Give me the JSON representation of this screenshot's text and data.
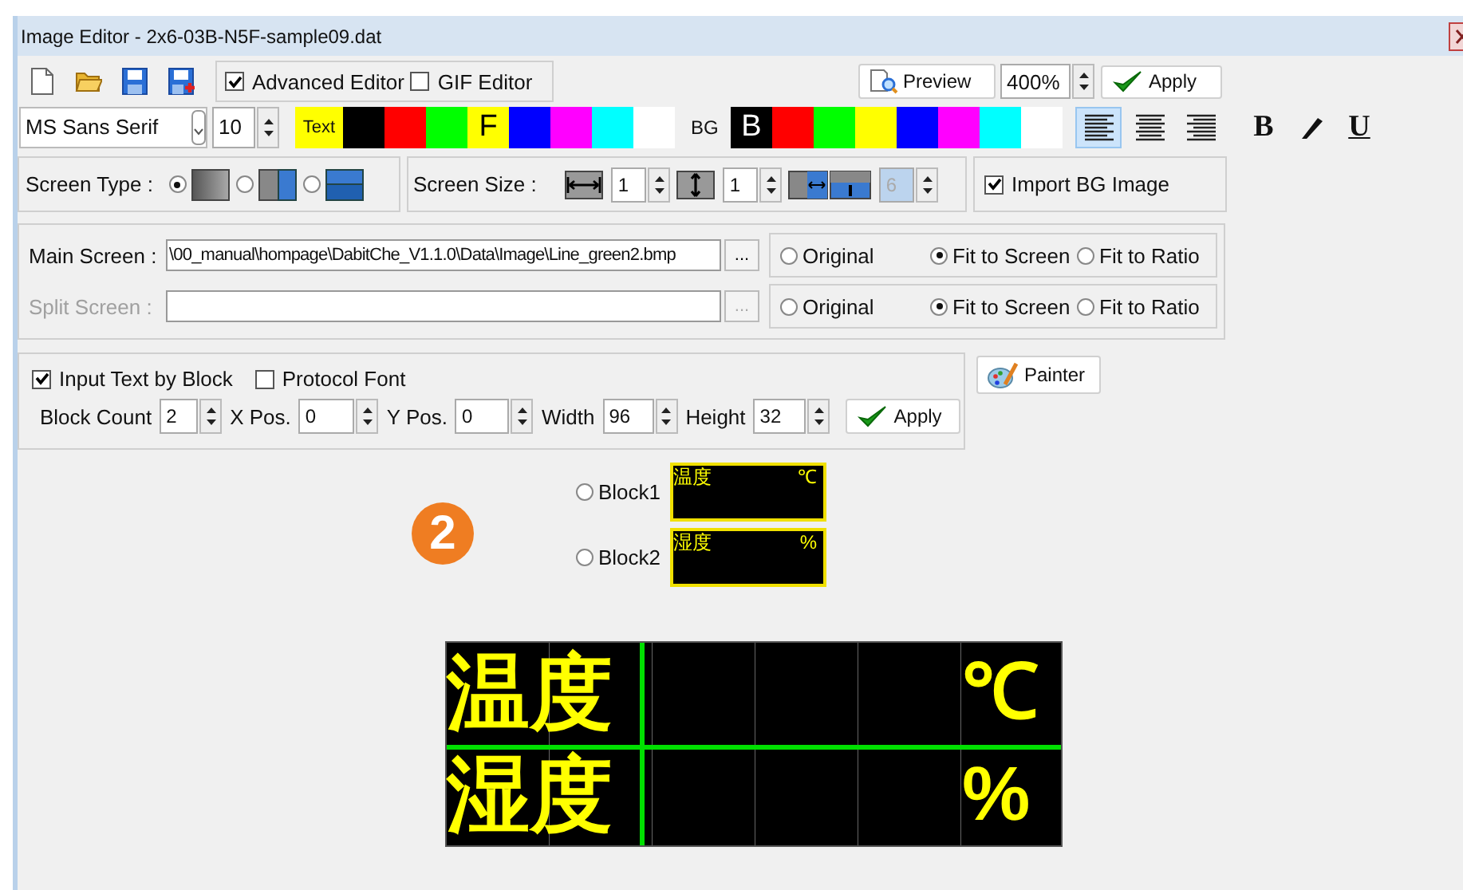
{
  "window": {
    "title": "Image Editor - 2x6-03B-N5F-sample09.dat"
  },
  "toolbar": {
    "editors": [
      {
        "label": "Advanced Editor",
        "checked": true
      },
      {
        "label": "GIF Editor",
        "checked": false
      }
    ],
    "preview_button": "Preview",
    "zoom": "400%",
    "apply_button": "Apply"
  },
  "format_bar": {
    "font": "MS Sans Serif",
    "size": "10",
    "text_label": "Text",
    "text_marker": "F",
    "text_colors": [
      {
        "color": "#000000",
        "selected": false
      },
      {
        "color": "#ff0000",
        "selected": false
      },
      {
        "color": "#00ff00",
        "selected": false
      },
      {
        "color": "#ffff00",
        "selected": true
      },
      {
        "color": "#0000ff",
        "selected": false
      },
      {
        "color": "#ff00ff",
        "selected": false
      },
      {
        "color": "#00ffff",
        "selected": false
      },
      {
        "color": "#ffffff",
        "selected": false
      }
    ],
    "bg_label": "BG",
    "bg_marker": "B",
    "bg_colors": [
      {
        "color": "#000000",
        "selected": true
      },
      {
        "color": "#ff0000",
        "selected": false
      },
      {
        "color": "#00ff00",
        "selected": false
      },
      {
        "color": "#ffff00",
        "selected": false
      },
      {
        "color": "#0000ff",
        "selected": false
      },
      {
        "color": "#ff00ff",
        "selected": false
      },
      {
        "color": "#00ffff",
        "selected": false
      },
      {
        "color": "#ffffff",
        "selected": false
      }
    ],
    "alignments": [
      {
        "kind": "left",
        "selected": true
      },
      {
        "kind": "center",
        "selected": false
      },
      {
        "kind": "right",
        "selected": false
      }
    ],
    "styles": [
      {
        "kind": "bold",
        "label": "B"
      },
      {
        "kind": "italic"
      },
      {
        "kind": "underline",
        "label": "U"
      }
    ]
  },
  "screen_type": {
    "label": "Screen Type :",
    "options": [
      {
        "kind": "single",
        "selected": true
      },
      {
        "kind": "vertical-split",
        "selected": false
      },
      {
        "kind": "horizontal-split",
        "selected": false
      }
    ]
  },
  "screen_size": {
    "label": "Screen Size :",
    "columns": "1",
    "rows": "1",
    "split": {
      "value": "6",
      "disabled": true
    }
  },
  "import_bg": {
    "label": "Import BG Image",
    "checked": true
  },
  "image_sources": [
    {
      "label": "Main Screen :",
      "path": "\\00_manual\\hompage\\DabitChe_V1.1.0\\Data\\Image\\Line_green2.bmp",
      "browse": "...",
      "disabled": false,
      "options": [
        {
          "label": "Original",
          "selected": false
        },
        {
          "label": "Fit to Screen",
          "selected": true
        },
        {
          "label": "Fit to Ratio",
          "selected": false
        }
      ]
    },
    {
      "label": "Split Screen :",
      "browse": "...",
      "disabled": true,
      "options": [
        {
          "label": "Original",
          "selected": false
        },
        {
          "label": "Fit to Screen",
          "selected": true
        },
        {
          "label": "Fit to Ratio",
          "selected": false
        }
      ]
    }
  ],
  "block_settings": {
    "options": [
      {
        "label": "Input Text by Block",
        "checked": true
      },
      {
        "label": "Protocol Font",
        "checked": false
      }
    ],
    "fields": [
      {
        "label": "Block Count",
        "value": "2"
      },
      {
        "label": "X Pos.",
        "value": "0"
      },
      {
        "label": "Y Pos.",
        "value": "0"
      },
      {
        "label": "Width",
        "value": "96"
      },
      {
        "label": "Height",
        "value": "32"
      }
    ],
    "apply_button": "Apply"
  },
  "painter_button": "Painter",
  "blocks": [
    {
      "label": "Block1",
      "selected": false,
      "text_left": "温度",
      "text_right": "℃"
    },
    {
      "label": "Block2",
      "selected": false,
      "text_left": "湿度",
      "text_right": "%"
    }
  ],
  "badge": "2",
  "display": {
    "rows": [
      {
        "left": "温度",
        "right": "℃"
      },
      {
        "left": "湿度",
        "right": "%"
      }
    ]
  }
}
